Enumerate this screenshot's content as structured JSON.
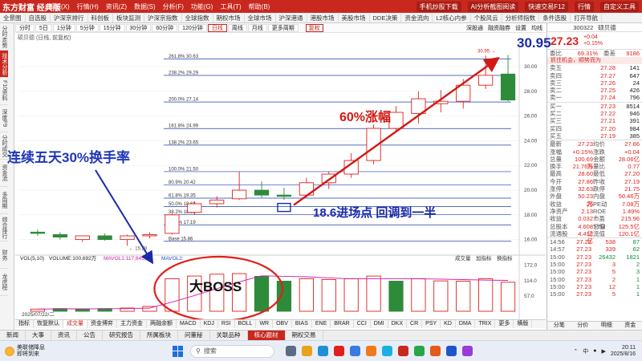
{
  "app": {
    "logo": "东方财富 经典版",
    "menu": [
      "系统(X)",
      "行情(H)",
      "资讯(Z)",
      "数据(S)",
      "分析(F)",
      "功能(G)",
      "工具(T)",
      "帮助(B)"
    ],
    "top_right": [
      "手机炒股下载",
      "AI分析截图阅读",
      "快速交易F12",
      "行情",
      "自定义工具"
    ]
  },
  "navbar": [
    "全景图",
    "自选股",
    "沪深京排行",
    "科创板",
    "板块监测",
    "沪深京指数",
    "全球指数",
    "期权市场",
    "全球市场",
    "沪深港通",
    "港股市场",
    "美股市场",
    "DDE决策",
    "资金流向",
    "L2核心内参",
    "个股风云",
    "分析师指数",
    "条件选股",
    "打开导航"
  ],
  "sidebar": [
    "分时走势",
    "技术分析",
    "F10资料",
    "深度F9",
    "分时成交",
    "资金流",
    "多周期",
    "综合排行",
    "财务",
    "龙虎榜"
  ],
  "toolbar": {
    "items": [
      "分时",
      "5日",
      "1分钟",
      "5分钟",
      "15分钟",
      "30分钟",
      "60分钟",
      "120分钟",
      "日线",
      "周线",
      "月线",
      "更多周期"
    ],
    "active": "日线",
    "fuquan": "复权",
    "right": [
      "深股通",
      "融资融券",
      "设置",
      "均线"
    ]
  },
  "stock_bar": "硕贝德 (日线, 前复权)",
  "indicator_header": {
    "vol": "VOL(5,10)",
    "volume": "VOLUME:100,692万",
    "mavol1": "MAVOL1:117,845万",
    "mavol2": "MAVOL2:",
    "right": [
      "成交量",
      "加指标",
      "换指标"
    ]
  },
  "indicator_tabs": [
    "指标",
    "恢复默认",
    "成交量",
    "资金博弈",
    "主力资金",
    "两融余额",
    "MACD",
    "KDJ",
    "RSI",
    "BOLL",
    "WR",
    "OBV",
    "BIAS",
    "ENE",
    "BRAR",
    "CCI",
    "DMI",
    "DKX",
    "CR",
    "PSY",
    "KD",
    "DMA",
    "TRIX",
    "更多",
    "横版"
  ],
  "indicator_active": "成交量",
  "date_label": "2025/07/22/二",
  "app_tabs": [
    "新闻",
    "大事",
    "资讯",
    "公告",
    "研究报告",
    "所属板块",
    "问董秘",
    "关联品种",
    "核心题材",
    "期权交易"
  ],
  "app_tabs_highlight": "核心题材",
  "panel": {
    "code": "300322",
    "name": "硕贝德",
    "price": "27.23",
    "change": "+0.04",
    "change_pct": "+0.15%",
    "weibi_label": "委比",
    "weibi": "69.31%",
    "weicha_label": "委差",
    "weicha": "9186",
    "news": "抓住机会，顺势而为",
    "asks": [
      {
        "label": "卖五",
        "price": "27.28",
        "vol": "141"
      },
      {
        "label": "卖四",
        "price": "27.27",
        "vol": "647"
      },
      {
        "label": "卖三",
        "price": "27.26",
        "vol": "24"
      },
      {
        "label": "卖二",
        "price": "27.25",
        "vol": "426"
      },
      {
        "label": "卖一",
        "price": "27.24",
        "vol": "796"
      }
    ],
    "bids": [
      {
        "label": "买一",
        "price": "27.23",
        "vol": "8514"
      },
      {
        "label": "买二",
        "price": "27.22",
        "vol": "946"
      },
      {
        "label": "买三",
        "price": "27.21",
        "vol": "391"
      },
      {
        "label": "买四",
        "price": "27.20",
        "vol": "984"
      },
      {
        "label": "买五",
        "price": "27.19",
        "vol": "385"
      }
    ],
    "stats": [
      {
        "k1": "最新",
        "v1": "27.23",
        "k2": "均价",
        "v2": "27.86"
      },
      {
        "k1": "涨幅",
        "v1": "+0.15%",
        "k2": "涨跌",
        "v2": "+0.04"
      },
      {
        "k1": "总量",
        "v1": "100.69万",
        "k2": "金额",
        "v2": "28.06亿"
      },
      {
        "k1": "换手",
        "v1": "21.76%",
        "k2": "量比",
        "v2": "0.77"
      },
      {
        "k1": "最高",
        "v1": "28.60",
        "k2": "最低",
        "v2": "27.20"
      },
      {
        "k1": "今开",
        "v1": "27.86",
        "k2": "昨收",
        "v2": "27.19"
      },
      {
        "k1": "涨停",
        "v1": "32.63",
        "k2": "跌停",
        "v2": "21.75"
      },
      {
        "k1": "外盘",
        "v1": "50.23万",
        "k2": "内盘",
        "v2": "50.46万"
      },
      {
        "k1": "收益",
        "v1": "26",
        "k2": "PE动",
        "v2": "7.08万"
      },
      {
        "k1": "净资产",
        "v1": "2.13",
        "k2": "ROE",
        "v2": "1.49%"
      },
      {
        "k1": "收益",
        "v1": "0.032",
        "k2": "市盈TTM",
        "v2": "215.96"
      },
      {
        "k1": "总股本",
        "v1": "4.608亿",
        "k2": "总值",
        "v2": "125.5亿"
      },
      {
        "k1": "流通股",
        "v1": "4.412亿",
        "k2": "流值",
        "v2": "120.1亿"
      }
    ],
    "ticks": [
      {
        "time": "14:56",
        "price": "27.23",
        "vol": "538",
        "n": "87"
      },
      {
        "time": "14:57",
        "price": "27.23",
        "vol": "339",
        "n": "62"
      },
      {
        "time": "15:00",
        "price": "27.23",
        "vol": "26432",
        "n": "1821"
      },
      {
        "time": "15:00",
        "price": "27.23",
        "vol": "3",
        "n": "2"
      },
      {
        "time": "15:00",
        "price": "27.23",
        "vol": "5",
        "n": "3"
      },
      {
        "time": "15:00",
        "price": "27.23",
        "vol": "2",
        "n": "1"
      },
      {
        "time": "15:00",
        "price": "27.23",
        "vol": "12",
        "n": "1"
      },
      {
        "time": "15:00",
        "price": "27.23",
        "vol": "5",
        "n": "1"
      }
    ],
    "tabs": [
      "分笔",
      "分价",
      "明细",
      "资金"
    ]
  },
  "annotations": {
    "turnover": "连续五天30%换手率",
    "rise": "60%涨幅",
    "entry": "18.6进场点   回调到一半",
    "boss": "大BOSS",
    "top_price": "30.95"
  },
  "taskbar": {
    "weather_title": "美联储降息",
    "weather_sub": "即将到来",
    "search": "搜索",
    "time": "20:11",
    "date": "2025/8/16",
    "lang": "中"
  },
  "colors": {
    "up": "#e0201b",
    "down": "#2e8b3a",
    "fib": "#1b3fb5",
    "annotation_blue": "#1a2aa8",
    "annotation_red": "#d11a14"
  },
  "chart_data": [
    {
      "type": "candlestick",
      "title": "硕贝德 (日线, 前复权)",
      "ylim": [
        15,
        31.5
      ],
      "y_ticks": [
        16.0,
        18.0,
        20.0,
        22.0,
        24.0,
        26.0,
        28.0,
        30.0
      ],
      "candles": [
        {
          "o": 16.6,
          "h": 16.8,
          "l": 16.3,
          "c": 16.5
        },
        {
          "o": 16.4,
          "h": 16.6,
          "l": 16.0,
          "c": 16.2
        },
        {
          "o": 16.0,
          "h": 16.3,
          "l": 15.8,
          "c": 16.3
        },
        {
          "o": 16.3,
          "h": 16.5,
          "l": 15.9,
          "c": 16.0
        },
        {
          "o": 16.0,
          "h": 16.4,
          "l": 15.5,
          "c": 16.3
        },
        {
          "o": 16.3,
          "h": 16.6,
          "l": 16.1,
          "c": 16.4
        },
        {
          "o": 16.5,
          "h": 18.1,
          "l": 16.4,
          "c": 18.0
        },
        {
          "o": 18.2,
          "h": 19.1,
          "l": 18.0,
          "c": 18.9
        },
        {
          "o": 18.9,
          "h": 19.5,
          "l": 18.6,
          "c": 19.2
        },
        {
          "o": 19.3,
          "h": 21.5,
          "l": 19.2,
          "c": 20.0
        },
        {
          "o": 20.0,
          "h": 20.7,
          "l": 19.4,
          "c": 19.6
        },
        {
          "o": 19.6,
          "h": 20.2,
          "l": 19.2,
          "c": 19.5
        },
        {
          "o": 19.6,
          "h": 21.0,
          "l": 19.4,
          "c": 20.6
        },
        {
          "o": 20.6,
          "h": 21.5,
          "l": 20.1,
          "c": 21.3
        },
        {
          "o": 21.3,
          "h": 23.0,
          "l": 21.0,
          "c": 22.4
        },
        {
          "o": 22.4,
          "h": 25.3,
          "l": 22.1,
          "c": 25.0
        },
        {
          "o": 25.0,
          "h": 26.8,
          "l": 24.7,
          "c": 26.3
        },
        {
          "o": 26.2,
          "h": 28.0,
          "l": 25.4,
          "c": 27.4
        },
        {
          "o": 27.0,
          "h": 28.1,
          "l": 26.3,
          "c": 27.2
        },
        {
          "o": 27.2,
          "h": 29.0,
          "l": 26.6,
          "c": 28.5
        },
        {
          "o": 28.5,
          "h": 30.9,
          "l": 28.2,
          "c": 29.3
        },
        {
          "o": 29.4,
          "h": 30.95,
          "l": 27.2,
          "c": 27.3
        }
      ],
      "fib_levels": [
        {
          "label": "261.8%",
          "value": 30.63
        },
        {
          "label": "238.2%",
          "value": 29.29
        },
        {
          "label": "200.0%",
          "value": 27.14
        },
        {
          "label": "161.8%",
          "value": 24.99
        },
        {
          "label": "138.2%",
          "value": 23.65
        },
        {
          "label": "100.0%",
          "value": 21.5
        },
        {
          "label": "80.9%",
          "value": 20.42
        },
        {
          "label": "61.8%",
          "value": 19.35
        },
        {
          "label": "50.0%",
          "value": 18.68
        },
        {
          "label": "38.2%",
          "value": 18.01
        },
        {
          "label": "23.6%",
          "value": 17.19
        },
        {
          "label": "Base",
          "value": 15.86
        }
      ],
      "high_marker": "30.95",
      "low_marker": "15.29"
    },
    {
      "type": "bar",
      "title": "VOL(5,10)",
      "ylim": [
        0,
        185
      ],
      "y_ticks": [
        57.0,
        114.0,
        172.0
      ],
      "values": [
        8,
        10,
        9,
        10,
        12,
        18,
        121,
        131,
        138,
        140,
        130,
        112,
        121,
        118,
        121,
        131,
        112,
        121,
        113,
        112,
        121,
        108
      ],
      "down_flags": [
        false,
        true,
        true,
        true,
        false,
        false,
        false,
        false,
        false,
        false,
        true,
        true,
        false,
        false,
        false,
        false,
        true,
        false,
        false,
        false,
        false,
        false
      ]
    }
  ]
}
